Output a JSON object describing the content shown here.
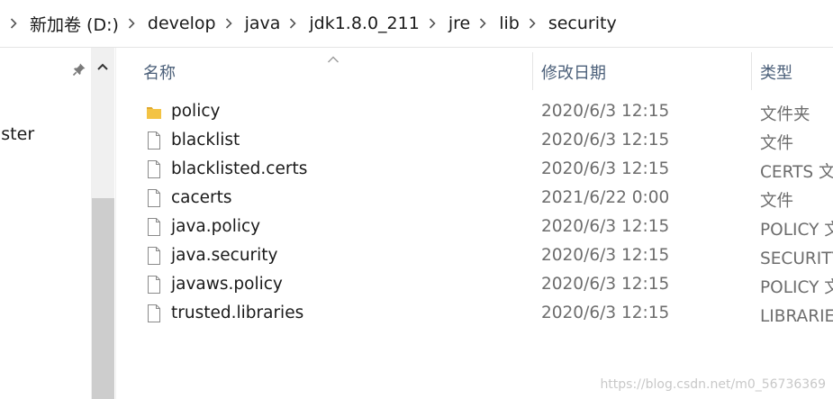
{
  "breadcrumb": [
    "新加卷 (D:)",
    "develop",
    "java",
    "jdk1.8.0_211",
    "jre",
    "lib",
    "security"
  ],
  "nav": {
    "partial_item": "ıster"
  },
  "columns": {
    "name": "名称",
    "date": "修改日期",
    "type": "类型"
  },
  "files": [
    {
      "name": "policy",
      "date": "2020/6/3 12:15",
      "type": "文件夹",
      "icon": "folder-icon"
    },
    {
      "name": "blacklist",
      "date": "2020/6/3 12:15",
      "type": "文件",
      "icon": "file-icon"
    },
    {
      "name": "blacklisted.certs",
      "date": "2020/6/3 12:15",
      "type": "CERTS 文件",
      "icon": "file-icon"
    },
    {
      "name": "cacerts",
      "date": "2021/6/22 0:00",
      "type": "文件",
      "icon": "file-icon"
    },
    {
      "name": "java.policy",
      "date": "2020/6/3 12:15",
      "type": "POLICY 文件",
      "icon": "file-icon"
    },
    {
      "name": "java.security",
      "date": "2020/6/3 12:15",
      "type": "SECURITY 文件",
      "icon": "file-icon"
    },
    {
      "name": "javaws.policy",
      "date": "2020/6/3 12:15",
      "type": "POLICY 文件",
      "icon": "file-icon"
    },
    {
      "name": "trusted.libraries",
      "date": "2020/6/3 12:15",
      "type": "LIBRARIES 文件",
      "icon": "file-icon"
    }
  ],
  "watermark": "https://blog.csdn.net/m0_56736369",
  "colors": {
    "folder": "#f3c344",
    "header_text": "#4c607a",
    "meta_text": "#6d6d6d"
  }
}
